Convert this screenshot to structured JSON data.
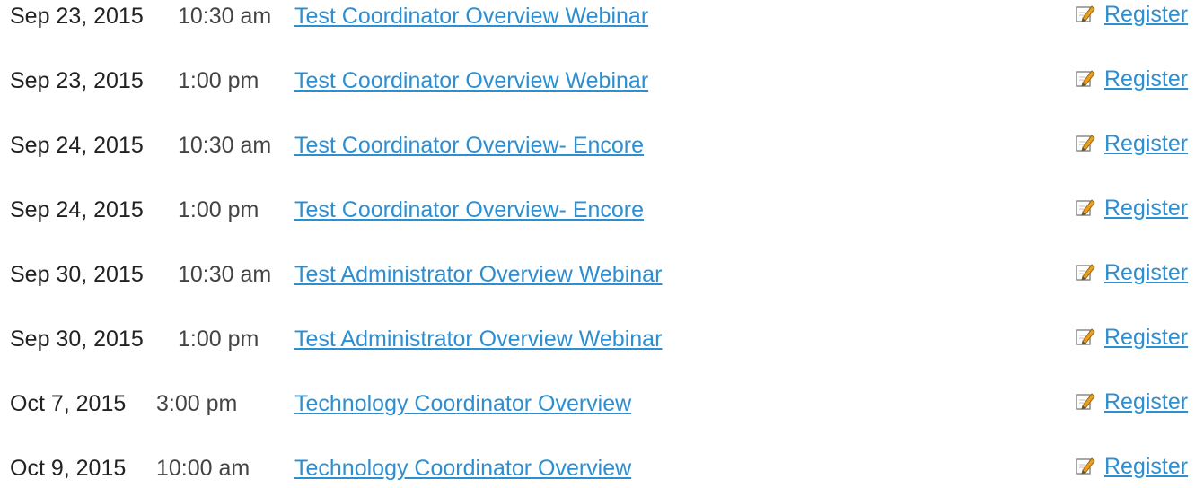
{
  "events": [
    {
      "date": "Sep 23, 2015",
      "time": "10:30 am",
      "title": "Test Coordinator Overview Webinar",
      "action": "Register"
    },
    {
      "date": "Sep 23, 2015",
      "time": "1:00 pm",
      "title": "Test Coordinator Overview Webinar",
      "action": "Register"
    },
    {
      "date": "Sep 24, 2015",
      "time": "10:30 am",
      "title": "Test Coordinator Overview- Encore",
      "action": "Register"
    },
    {
      "date": "Sep 24, 2015",
      "time": "1:00 pm",
      "title": "Test Coordinator Overview- Encore",
      "action": "Register"
    },
    {
      "date": "Sep 30, 2015",
      "time": "10:30 am",
      "title": "Test Administrator Overview Webinar",
      "action": "Register"
    },
    {
      "date": "Sep 30, 2015",
      "time": "1:00 pm",
      "title": "Test Administrator Overview Webinar",
      "action": "Register"
    },
    {
      "date": "Oct 7, 2015",
      "time": "3:00 pm",
      "title": "Technology Coordinator Overview",
      "action": "Register"
    },
    {
      "date": "Oct 9, 2015",
      "time": "10:00 am",
      "title": "Technology Coordinator Overview",
      "action": "Register"
    }
  ],
  "icons": {
    "register": "edit-pencil-icon"
  },
  "colors": {
    "link": "#2d8fd1",
    "text": "#222222"
  }
}
